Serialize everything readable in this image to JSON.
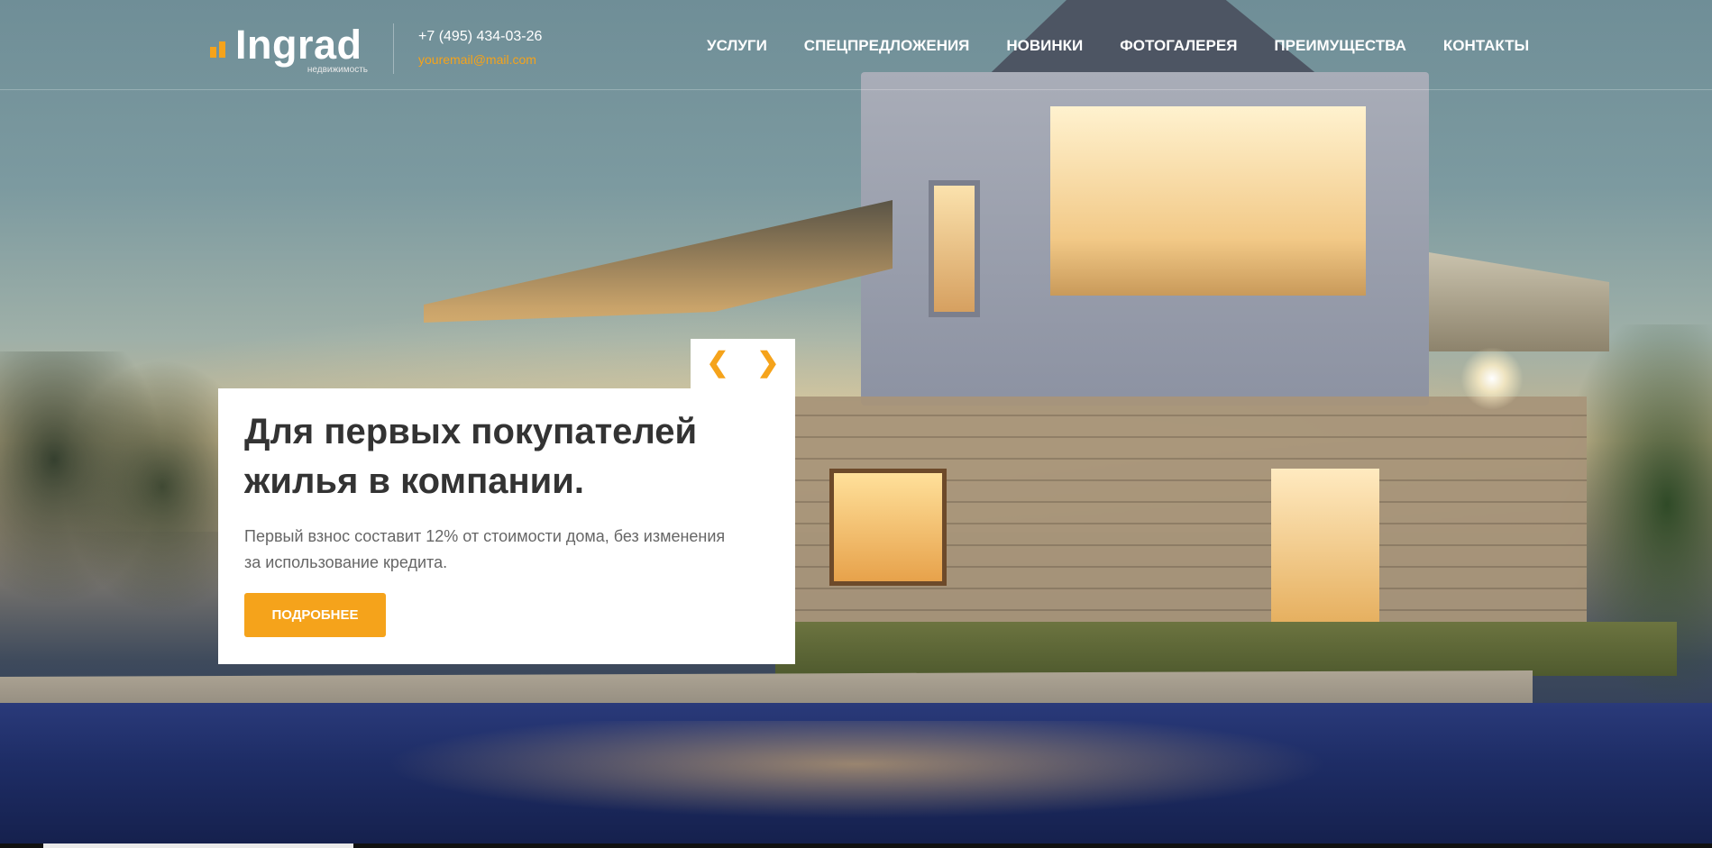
{
  "header": {
    "logo": {
      "text": "Ingrad",
      "subtitle": "недвижимость",
      "accent_color": "#f5a31b"
    },
    "phone": "+7 (495) 434-03-26",
    "email": "youremail@mail.com",
    "nav": [
      {
        "label": "УСЛУГИ"
      },
      {
        "label": "СПЕЦПРЕДЛОЖЕНИЯ"
      },
      {
        "label": "НОВИНКИ"
      },
      {
        "label": "ФОТОГАЛЕРЕЯ"
      },
      {
        "label": "ПРЕИМУЩЕСТВА"
      },
      {
        "label": "КОНТАКТЫ"
      }
    ]
  },
  "slider": {
    "title": "Для первых покупателей жилья в компании.",
    "text": "Первый взнос составит 12% от стоимости дома, без изменения за использование кредита.",
    "button_label": "ПОДРОБНЕЕ",
    "prev_icon": "chevron-left-icon",
    "next_icon": "chevron-right-icon",
    "button_color": "#f5a31b"
  }
}
